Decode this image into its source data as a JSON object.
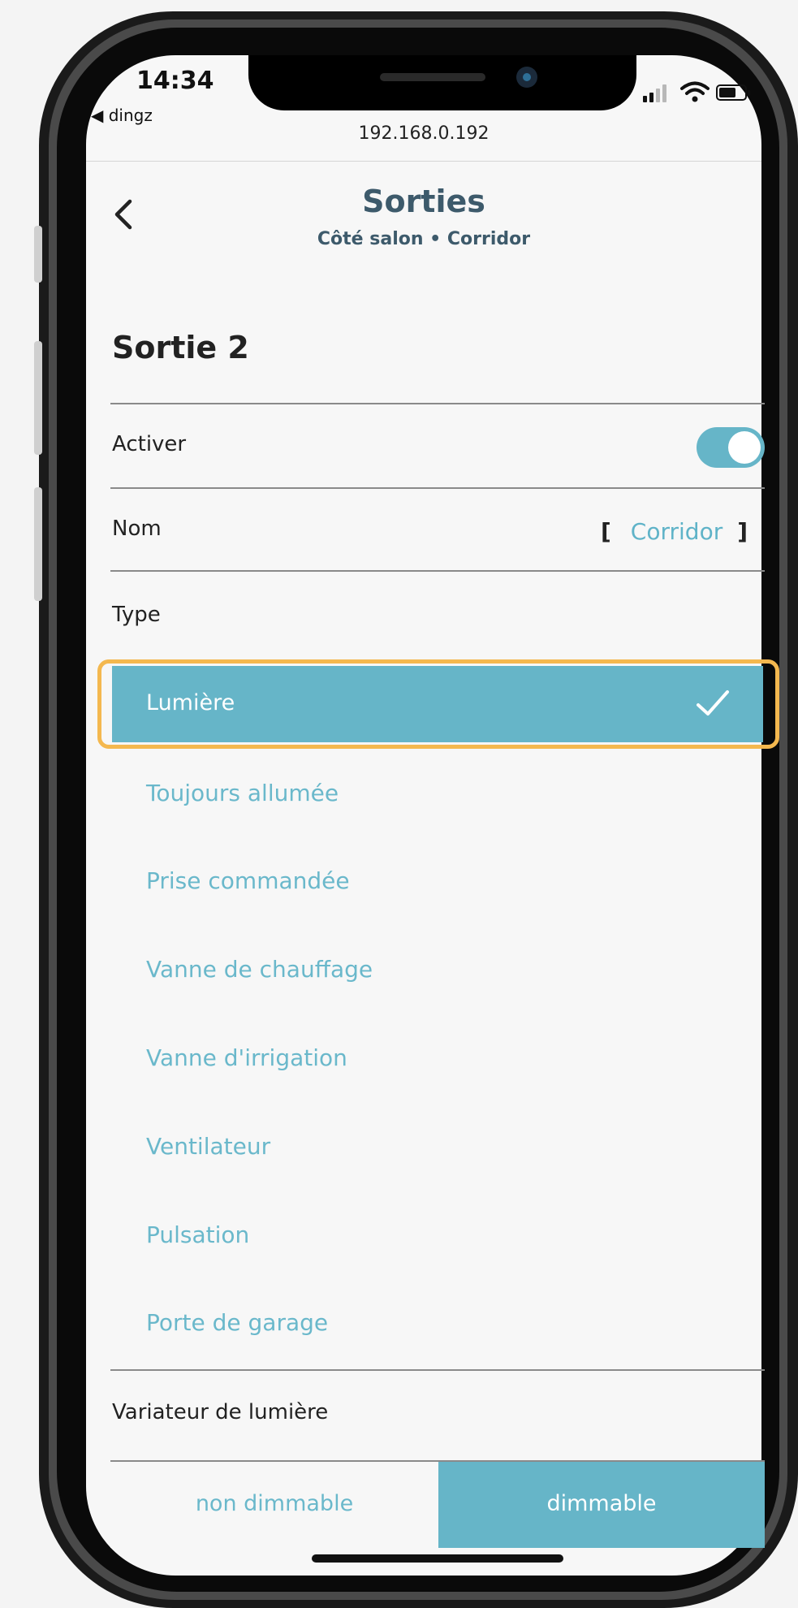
{
  "status_bar": {
    "time": "14:34",
    "back_app": "◀ dingz"
  },
  "browser": {
    "url": "192.168.0.192"
  },
  "header": {
    "title": "Sorties",
    "subtitle": "Côté salon • Corridor"
  },
  "section": {
    "title": "Sortie 2"
  },
  "rows": {
    "activate_label": "Activer",
    "activate_on": true,
    "name_label": "Nom",
    "name_bracket_open": "[",
    "name_value": "Corridor",
    "name_bracket_close": "]",
    "type_label": "Type"
  },
  "type_options": {
    "selected": "Lumière",
    "others": [
      "Toujours allumée",
      "Prise commandée",
      "Vanne de chauffage",
      "Vanne d'irrigation",
      "Ventilateur",
      "Pulsation",
      "Porte de garage"
    ]
  },
  "dimmer": {
    "label": "Variateur de lumière",
    "option_off": "non dimmable",
    "option_on": "dimmable",
    "selected": "dimmable"
  },
  "colors": {
    "accent": "#66b5c8",
    "accent_text": "#6ab8cb",
    "title_color": "#3d5a6b",
    "highlight_border": "#f4b84f"
  },
  "icons": {
    "back": "chevron-left-icon",
    "check": "checkmark-icon",
    "signal": "signal-icon",
    "wifi": "wifi-icon",
    "battery": "battery-icon"
  }
}
